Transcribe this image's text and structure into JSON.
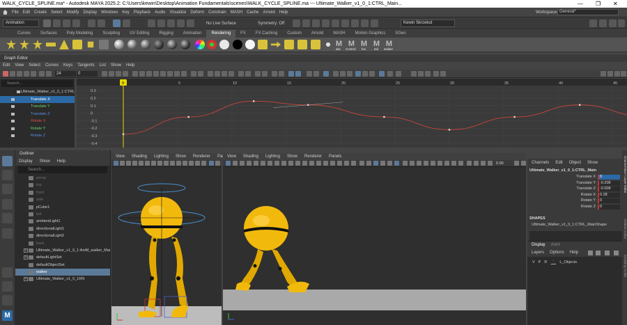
{
  "title_bar": {
    "title": "WALK_CYCLE_SPLINE.ma* - Autodesk MAYA 2025.2: C:\\Users\\kewin\\Desktop\\Animation Fundamentals\\scenes\\WALK_CYCLE_SPLINE.ma   ---   Ultimate_Walker_v1_0_1:CTRL_Main...",
    "minimize": "—",
    "maximize": "❐",
    "close": "✕"
  },
  "main_menu": [
    "File",
    "Edit",
    "Create",
    "Select",
    "Modify",
    "Display",
    "Windows",
    "Key",
    "Playback",
    "Audio",
    "Visualize",
    "Deform",
    "Constrain",
    "MASH",
    "Cache",
    "Arnold",
    "Help"
  ],
  "workspace": {
    "label": "Workspace:",
    "value": "General*"
  },
  "status_line": {
    "mode": "Animation",
    "live_surface": "No Live Surface",
    "symmetry": "Symmetry: Off",
    "user": "Kewin Skrzekut"
  },
  "shelf_tabs": [
    "Curves",
    "Surfaces",
    "Poly Modeling",
    "Sculpting",
    "UV Editing",
    "Rigging",
    "Animation",
    "Rendering",
    "FX",
    "FX Caching",
    "Custom",
    "Arnold",
    "MASH",
    "Motion Graphics",
    "XGen"
  ],
  "shelf_active": "Rendering",
  "shelf_labels": [
    "abc",
    "Control",
    "fox",
    "tail",
    "walker"
  ],
  "graph_editor": {
    "title": "Graph Editor",
    "menu": [
      "Edit",
      "View",
      "Select",
      "Curves",
      "Keys",
      "Tangents",
      "List",
      "Show",
      "Help"
    ],
    "frame_field": "24",
    "value_field": "0",
    "search_placeholder": "Search...",
    "outliner_rows": [
      {
        "label": "Ultimate_Walker_v1_0_1:CTRL",
        "color": "#cccccc"
      },
      {
        "label": "Translate X",
        "color": "#ffffff",
        "selected": true
      },
      {
        "label": "Translate Y",
        "color": "#6ad46a"
      },
      {
        "label": "Translate Z",
        "color": "#5a8fe0"
      },
      {
        "label": "Rotate X",
        "color": "#e04a4a"
      },
      {
        "label": "Rotate Y",
        "color": "#6ad46a"
      },
      {
        "label": "Rotate Z",
        "color": "#5a8fe0"
      }
    ],
    "time_ticks": [
      "5",
      "10",
      "15",
      "20",
      "25",
      "30",
      "35",
      "40",
      "45",
      "50"
    ],
    "current_frame": "0",
    "end_frame": "48",
    "value_ticks": [
      "0.3",
      "0.2",
      "0.1",
      "0",
      "-0.1",
      "-0.2",
      "-0.3",
      "-0.4"
    ]
  },
  "chart_data": {
    "type": "line",
    "series": [
      {
        "name": "Translate X",
        "color": "#c8453a",
        "x": [
          0,
          6,
          12,
          17,
          24,
          30,
          36,
          42,
          48
        ],
        "values": [
          -0.28,
          -0.05,
          0.16,
          0.11,
          -0.05,
          -0.22,
          -0.05,
          0.11,
          -0.04
        ]
      }
    ],
    "xlim": [
      0,
      50
    ],
    "ylim": [
      -0.42,
      0.33
    ],
    "grid": true
  },
  "outliner": {
    "title": "Outliner",
    "menu": [
      "Display",
      "Show",
      "Help"
    ],
    "search_placeholder": "Search...",
    "rows": [
      {
        "label": "persp",
        "dim": true
      },
      {
        "label": "top",
        "dim": true
      },
      {
        "label": "front",
        "dim": true
      },
      {
        "label": "side",
        "dim": true
      },
      {
        "label": "pCube1",
        "dim": false
      },
      {
        "label": "bot",
        "dim": true
      },
      {
        "label": "ambientLight1",
        "dim": false
      },
      {
        "label": "directionalLight1",
        "dim": false
      },
      {
        "label": "directionalLight2",
        "dim": false
      },
      {
        "label": "back",
        "dim": true
      },
      {
        "label": "Ultimate_Walker_v1_0_1:AniM_walker_Main",
        "dim": false,
        "expand": true
      },
      {
        "label": "defaultLightSet",
        "dim": false,
        "expand": true
      },
      {
        "label": "defaultObjectSet",
        "dim": false
      },
      {
        "label": "walker",
        "dim": false,
        "selected": true
      },
      {
        "label": "Ultimate_Walker_v1_0_1RN",
        "dim": false,
        "expand": true
      }
    ]
  },
  "viewport_menu": [
    "View",
    "Shading",
    "Lighting",
    "Show",
    "Renderer",
    "Panels"
  ],
  "viewport_right_field": "0.00",
  "channel_box": {
    "tabs": [
      "Channels",
      "Edit",
      "Object",
      "Show"
    ],
    "node": "Ultimate_Walker_v1_0_1:CTRL_Main",
    "channels": [
      {
        "label": "Translate X",
        "value": "0",
        "selected": true
      },
      {
        "label": "Translate Y",
        "value": "-0.208"
      },
      {
        "label": "Translate Z",
        "value": "-0.008"
      },
      {
        "label": "Rotate X",
        "value": "0.28"
      },
      {
        "label": "Rotate Y",
        "value": "0"
      },
      {
        "label": "Rotate Z",
        "value": "0"
      }
    ],
    "shapes_header": "SHAPES",
    "shape_node": "Ultimate_Walker_v1_0_1:CTRL_MainShape"
  },
  "layer_editor": {
    "tabs": [
      "Display",
      "Anim"
    ],
    "menu": [
      "Layers",
      "Options",
      "Help"
    ],
    "layer_flags": [
      "V",
      "P",
      "R"
    ],
    "layer_name": "L_Objects"
  },
  "side_tabs": [
    "Channel Box / Layer Editor",
    "Attribute Editor",
    "Modeling Toolkit"
  ],
  "corner_logo": "M"
}
